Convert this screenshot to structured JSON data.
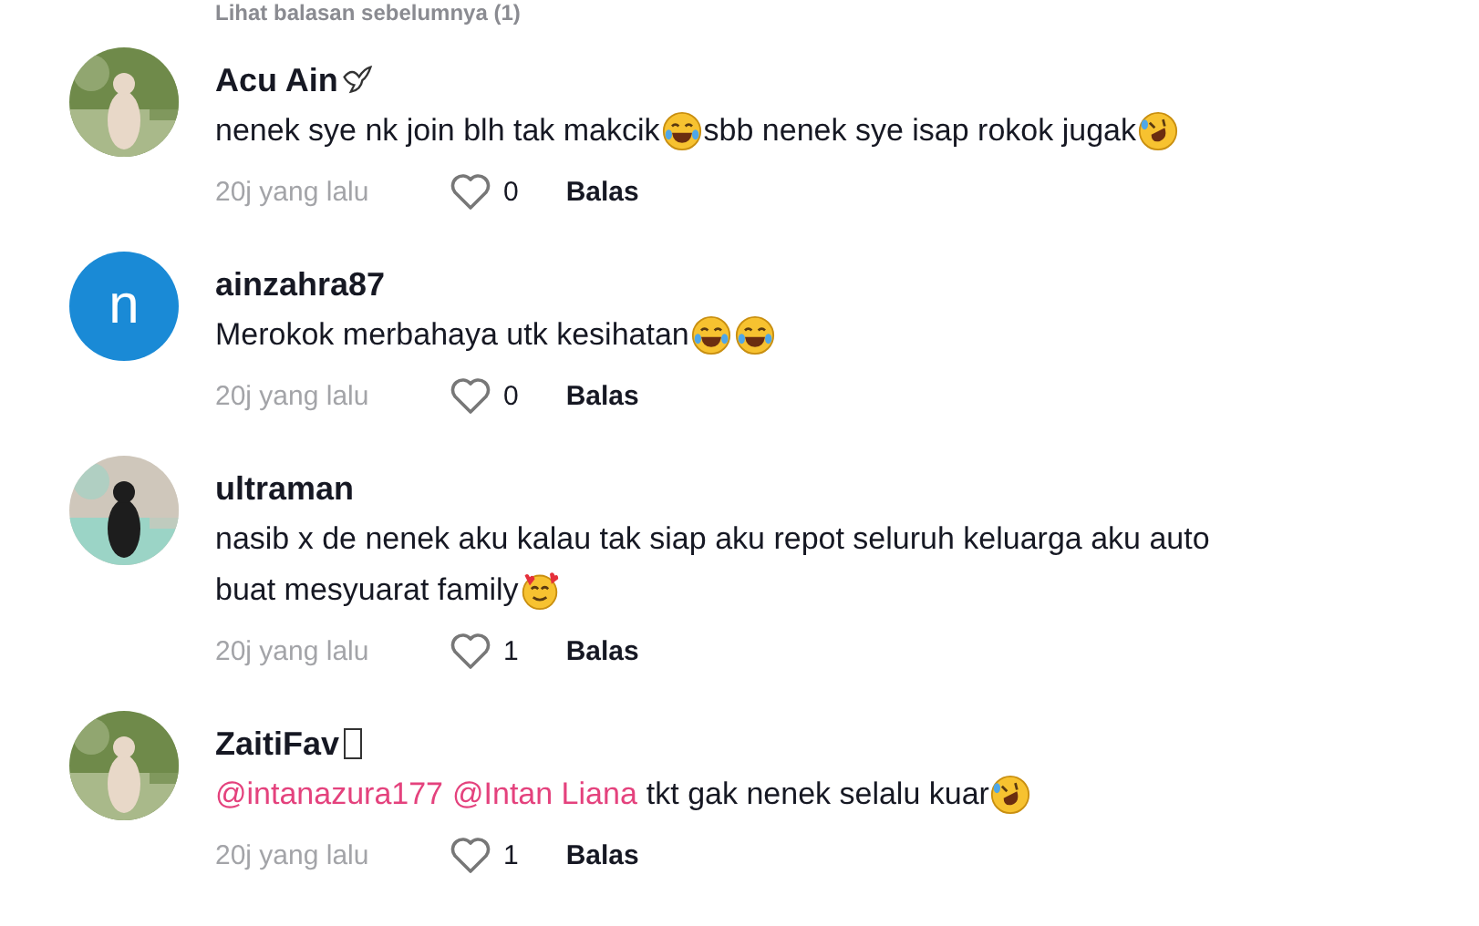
{
  "previous_replies": "Lihat balasan sebelumnya (1)",
  "comments": [
    {
      "username": "Acu Ain",
      "name_icon": {
        "kind": "dove"
      },
      "body": [
        {
          "kind": "text",
          "text": "nenek sye nk join blh tak makcik"
        },
        {
          "kind": "tears_joy"
        },
        {
          "kind": "text",
          "text": "sbb nenek sye isap rokok jugak"
        },
        {
          "kind": "rofl"
        }
      ],
      "time": "20j yang lalu",
      "likes": "0",
      "reply": "Balas"
    },
    {
      "username": "ainzahra87",
      "avatar": {
        "kind": "letter",
        "letter": "n",
        "color": "#1a8ad6"
      },
      "body": [
        {
          "kind": "text",
          "text": "Merokok merbahaya utk kesihatan"
        },
        {
          "kind": "tears_joy"
        },
        {
          "kind": "tears_joy"
        }
      ],
      "time": "20j yang lalu",
      "likes": "0",
      "reply": "Balas"
    },
    {
      "username": "ultraman",
      "body": [
        {
          "kind": "text",
          "text": "nasib x de nenek aku kalau tak siap aku repot seluruh keluarga aku auto"
        },
        {
          "kind": "break"
        },
        {
          "kind": "text",
          "text": "buat mesyuarat family"
        },
        {
          "kind": "hearts"
        }
      ],
      "time": "20j yang lalu",
      "likes": "1",
      "reply": "Balas"
    },
    {
      "username": "ZaitiFav",
      "name_icon": {
        "kind": "missing_glyph"
      },
      "body": [
        {
          "kind": "mention",
          "text": "@intanazura177"
        },
        {
          "kind": "mention",
          "text": "@Intan Liana"
        },
        {
          "kind": "text",
          "text": "tkt gak nenek selalu kuar"
        },
        {
          "kind": "rofl"
        }
      ],
      "time": "20j yang lalu",
      "likes": "1",
      "reply": "Balas"
    }
  ]
}
